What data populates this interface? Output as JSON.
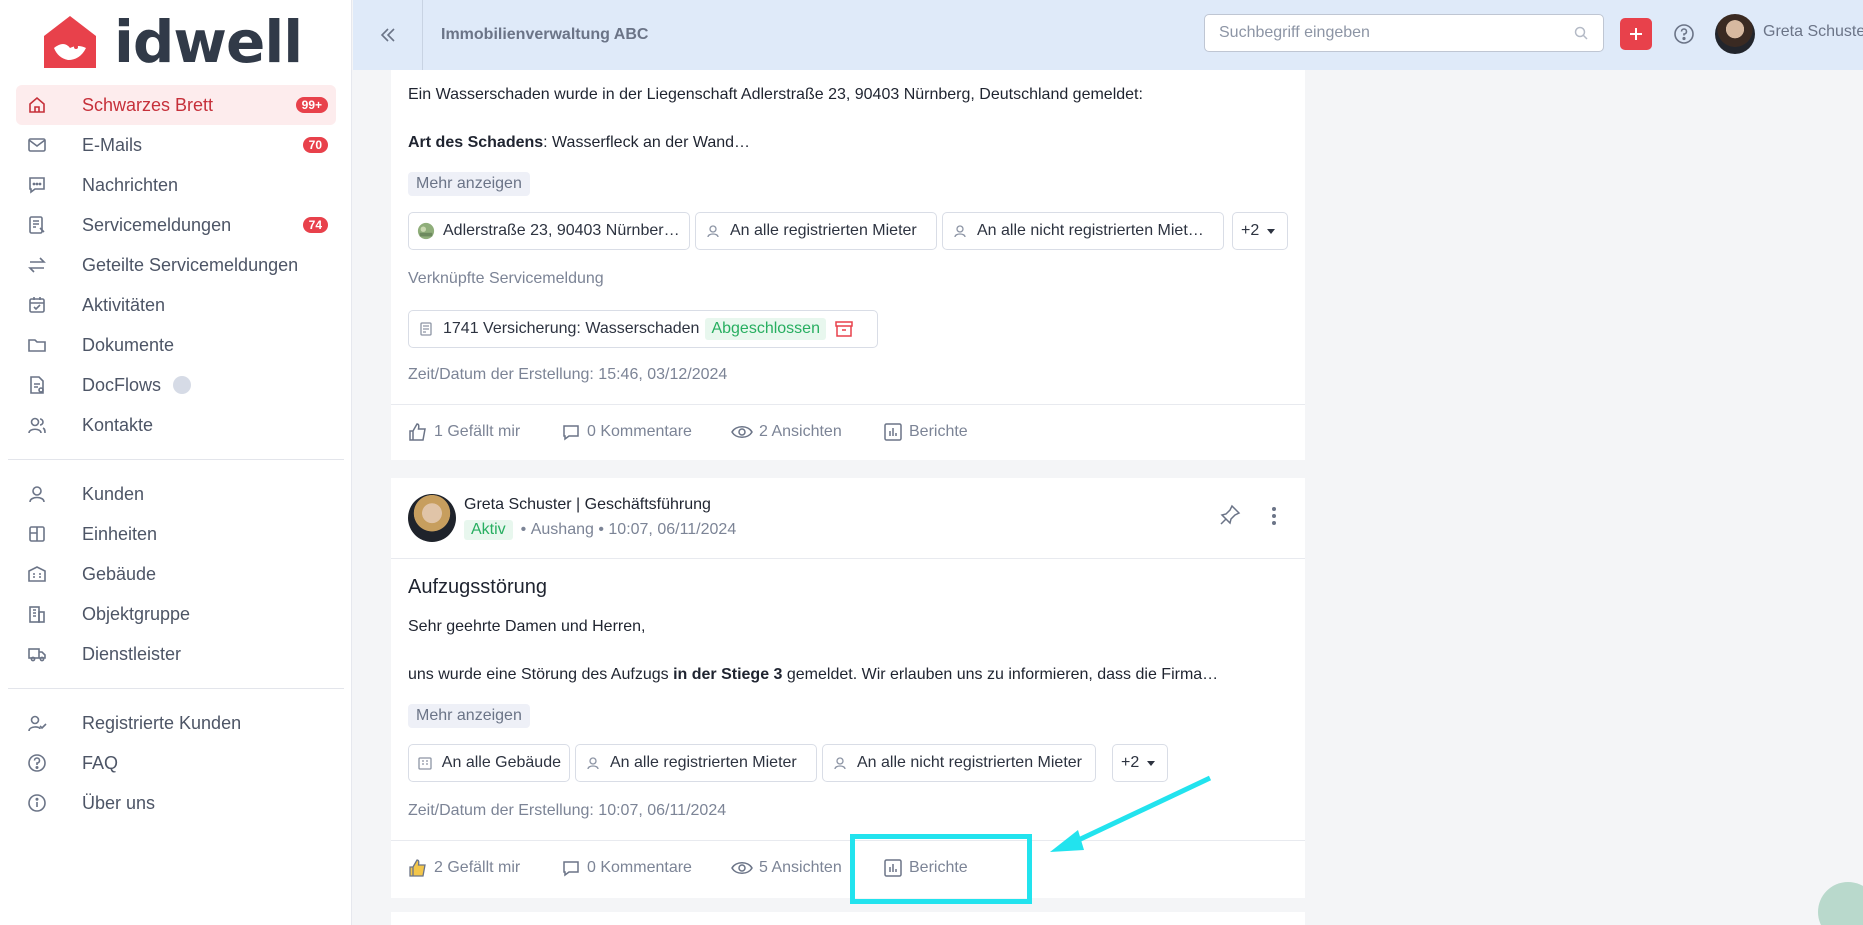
{
  "brand": {
    "name": "idwell"
  },
  "sidebar": {
    "primary": [
      {
        "label": "Schwarzes Brett",
        "badge": "99+",
        "icon": "home-icon",
        "active": true
      },
      {
        "label": "E-Mails",
        "badge": "70",
        "icon": "mail-icon"
      },
      {
        "label": "Nachrichten",
        "badge": "",
        "icon": "chat-icon"
      },
      {
        "label": "Servicemeldungen",
        "badge": "74",
        "icon": "service-icon"
      },
      {
        "label": "Geteilte Servicemeldungen",
        "badge": "",
        "icon": "swap-icon"
      },
      {
        "label": "Aktivitäten",
        "badge": "",
        "icon": "calendar-check-icon"
      },
      {
        "label": "Dokumente",
        "badge": "",
        "icon": "folder-icon"
      },
      {
        "label": "DocFlows",
        "badge": "",
        "icon": "docflow-icon"
      },
      {
        "label": "Kontakte",
        "badge": "",
        "icon": "contacts-icon"
      }
    ],
    "secondary": [
      {
        "label": "Kunden",
        "icon": "user-icon"
      },
      {
        "label": "Einheiten",
        "icon": "unit-icon"
      },
      {
        "label": "Gebäude",
        "icon": "building-icon"
      },
      {
        "label": "Objektgruppe",
        "icon": "object-group-icon"
      },
      {
        "label": "Dienstleister",
        "icon": "truck-icon"
      }
    ],
    "tertiary": [
      {
        "label": "Registrierte Kunden",
        "icon": "user-check-icon"
      },
      {
        "label": "FAQ",
        "icon": "help-circle-icon"
      },
      {
        "label": "Über uns",
        "icon": "info-icon"
      }
    ]
  },
  "header": {
    "org": "Immobilienverwaltung ABC",
    "search_placeholder": "Suchbegriff eingeben",
    "user_name": "Greta Schuster"
  },
  "post1": {
    "body_line1": "Ein Wasserschaden wurde in der Liegenschaft Adlerstraße 23, 90403 Nürnberg, Deutschland gemeldet:",
    "body_bold": "Art des Schadens",
    "body_rest": ": Wasserfleck an der Wand…",
    "more": "Mehr anzeigen",
    "chips": [
      "Adlerstraße 23, 90403 Nürnber…",
      "An alle registrierten Mieter",
      "An alle nicht registrierten Miet…",
      "+2"
    ],
    "linked_label": "Verknüpfte Servicemeldung",
    "linked_title": "1741 Versicherung: Wasserschaden",
    "linked_status": "Abgeschlossen",
    "created": "Zeit/Datum der Erstellung: 15:46, 03/12/2024",
    "likes": "1 Gefällt mir",
    "comments": "0 Kommentare",
    "views": "2 Ansichten",
    "reports": "Berichte"
  },
  "post2": {
    "author": "Greta Schuster | Geschäftsführung",
    "status": "Aktiv",
    "type": "Aushang",
    "time": "10:07, 06/11/2024",
    "title": "Aufzugsstörung",
    "greeting": "Sehr geehrte Damen und Herren,",
    "body_pre": "uns wurde eine Störung des Aufzugs ",
    "body_bold": "in der Stiege 3",
    "body_post": " gemeldet. Wir erlauben uns zu informieren, dass die Firma…",
    "more": "Mehr anzeigen",
    "chips": [
      "An alle Gebäude",
      "An alle registrierten Mieter",
      "An alle nicht registrierten Mieter",
      "+2"
    ],
    "created": "Zeit/Datum der Erstellung: 10:07, 06/11/2024",
    "likes": "2 Gefällt mir",
    "comments": "0 Kommentare",
    "views": "5 Ansichten",
    "reports": "Berichte"
  },
  "colors": {
    "accent": "#e8414b",
    "header_bg": "#dfeaf9",
    "highlight": "#22e3ee",
    "success": "#27ae60"
  }
}
